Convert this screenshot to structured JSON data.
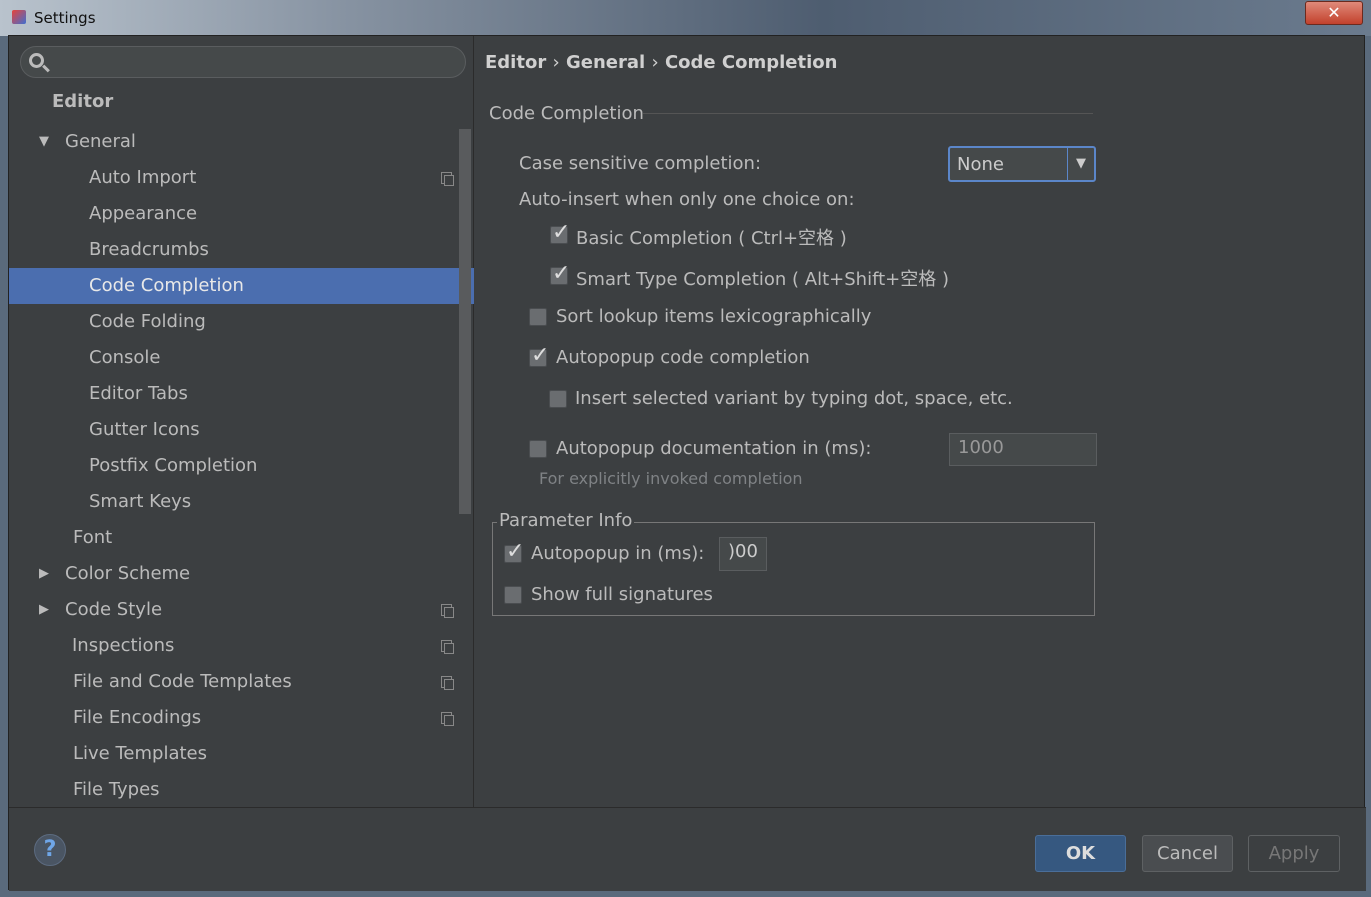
{
  "window": {
    "title": "Settings",
    "close": "✕"
  },
  "sidebar": {
    "section": "Editor",
    "items": [
      {
        "label": "General",
        "arrow": "▼"
      },
      {
        "label": "Auto Import"
      },
      {
        "label": "Appearance"
      },
      {
        "label": "Breadcrumbs"
      },
      {
        "label": "Code Completion"
      },
      {
        "label": "Code Folding"
      },
      {
        "label": "Console"
      },
      {
        "label": "Editor Tabs"
      },
      {
        "label": "Gutter Icons"
      },
      {
        "label": "Postfix Completion"
      },
      {
        "label": "Smart Keys"
      },
      {
        "label": "Font"
      },
      {
        "label": "Color Scheme",
        "arrow": "▶"
      },
      {
        "label": "Code Style",
        "arrow": "▶"
      },
      {
        "label": "Inspections"
      },
      {
        "label": "File and Code Templates"
      },
      {
        "label": "File Encodings"
      },
      {
        "label": "Live Templates"
      },
      {
        "label": "File Types"
      }
    ]
  },
  "breadcrumb": {
    "a": "Editor",
    "b": "General",
    "c": "Code Completion",
    "sep": "›"
  },
  "main": {
    "section": "Code Completion",
    "case_label": "Case sensitive completion:",
    "case_value": "None",
    "auto_insert": "Auto-insert when only one choice on:",
    "basic": "Basic Completion ( Ctrl+空格 )",
    "smart": "Smart Type Completion ( Alt+Shift+空格 )",
    "sort": "Sort lookup items lexicographically",
    "autopopup": "Autopopup code completion",
    "insert_variant": "Insert selected variant by typing dot, space, etc.",
    "autopopup_doc": "Autopopup documentation in (ms):",
    "autopopup_doc_value": "1000",
    "hint": "For explicitly invoked completion",
    "param_title": "Parameter Info",
    "param_autopopup": "Autopopup in (ms):",
    "param_value": ")00",
    "full_sig": "Show full signatures"
  },
  "buttons": {
    "help": "?",
    "ok": "OK",
    "cancel": "Cancel",
    "apply": "Apply"
  },
  "colors": {
    "background": "#3c3f41",
    "selection": "#4b6eaf",
    "ok_button": "#365880"
  }
}
